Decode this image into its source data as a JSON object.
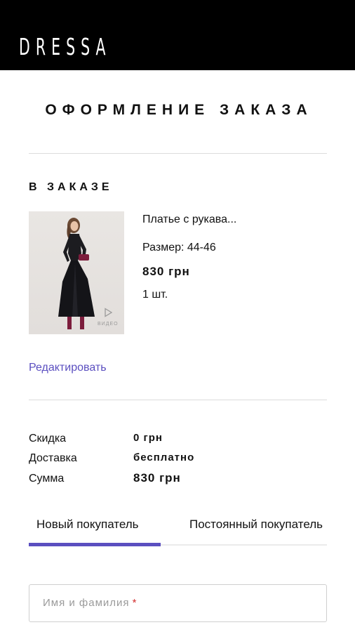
{
  "header": {
    "logo": "DRESSA",
    "background": "#000000"
  },
  "page": {
    "title": "ОФОРМЛЕНИЕ ЗАКАЗА"
  },
  "order": {
    "section_title": "В ЗАКАЗЕ",
    "item": {
      "image_icon": "video-play-icon",
      "image_badge": "ВИДЕО",
      "name": "Платье с рукава...",
      "size": "Размер: 44-46",
      "price": "830 грн",
      "quantity": "1 шт."
    },
    "edit_label": "Редактировать"
  },
  "summary": {
    "discount_label": "Скидка",
    "discount_value": "0 грн",
    "delivery_label": "Доставка",
    "delivery_value": "бесплатно",
    "total_label": "Сумма",
    "total_value": "830 грн"
  },
  "tabs": {
    "items": [
      {
        "label": "Новый покупатель",
        "active": true
      },
      {
        "label": "Постоянный покупатель",
        "active": false
      }
    ],
    "accent": "#5b4fc0"
  },
  "form": {
    "name_placeholder": "Имя и фамилия",
    "required_mark": "*"
  }
}
